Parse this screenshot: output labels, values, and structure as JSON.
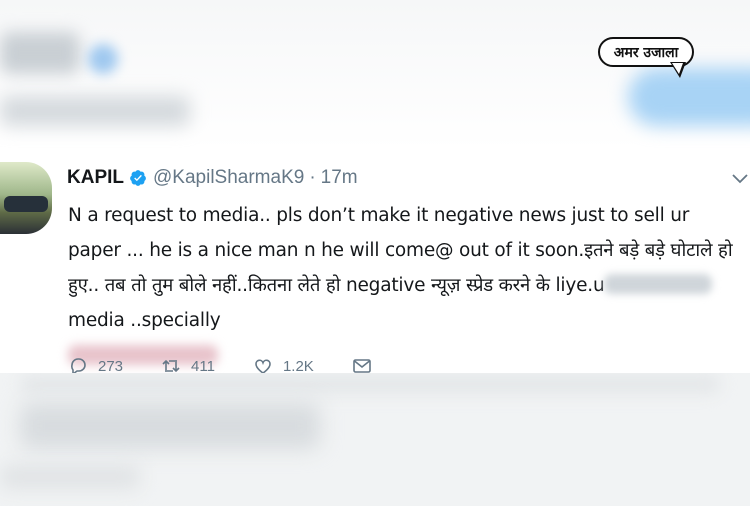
{
  "logo": {
    "text": "अमर उजाला"
  },
  "tweet": {
    "name": "KAPIL",
    "handle": "@KapilSharmaK9",
    "separator": "·",
    "time": "17m",
    "text_part1": "N a request to media.. pls don’t make it negative news just to sell ur paper ... he is a nice man n he will come@ out of it soon.इतने बड़े बड़े घोटाले हो हुए.. तब तो तुम बोले नहीं..कितना लेते हो negative न्यूज़ स्प्रेड करने के liye.u",
    "text_part2": "media ..specially",
    "verified_color": "#1da1f2"
  },
  "actions": {
    "reply_count": "273",
    "retweet_count": "411",
    "like_count": "1.2K"
  },
  "icons": [
    "verified-icon",
    "chevron-down-icon",
    "reply-icon",
    "retweet-icon",
    "like-icon",
    "message-icon"
  ]
}
